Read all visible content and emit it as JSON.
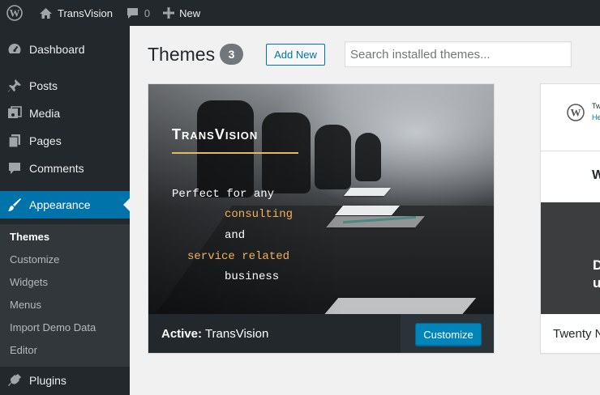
{
  "adminbar": {
    "site_name": "TransVision",
    "comments_count": "0",
    "new_label": "New"
  },
  "sidebar": {
    "items": [
      {
        "label": "Dashboard",
        "icon": "dashboard-icon"
      },
      {
        "label": "Posts",
        "icon": "pin-icon"
      },
      {
        "label": "Media",
        "icon": "media-icon"
      },
      {
        "label": "Pages",
        "icon": "pages-icon"
      },
      {
        "label": "Comments",
        "icon": "comment-icon"
      },
      {
        "label": "Appearance",
        "icon": "brush-icon"
      },
      {
        "label": "Plugins",
        "icon": "plugin-icon"
      }
    ],
    "submenu": [
      "Themes",
      "Customize",
      "Widgets",
      "Menus",
      "Import Demo Data",
      "Editor"
    ]
  },
  "main": {
    "title": "Themes",
    "count": "3",
    "add_new": "Add New",
    "search_placeholder": "Search installed themes..."
  },
  "themes": [
    {
      "brand": "TransVision",
      "tagline": [
        "Perfect for any",
        "consulting",
        "and",
        "service related",
        "business"
      ],
      "active_prefix": "Active:",
      "name": "TransVision",
      "action": "Customize"
    },
    {
      "name": "Twenty N",
      "small_title": "Tw",
      "small_link": "He",
      "big_letter": "W",
      "dark_lines": [
        "D",
        "u"
      ]
    }
  ],
  "colors": {
    "accent": "#0073aa",
    "adminbar": "#23282d",
    "highlight": "#f0b25a"
  }
}
